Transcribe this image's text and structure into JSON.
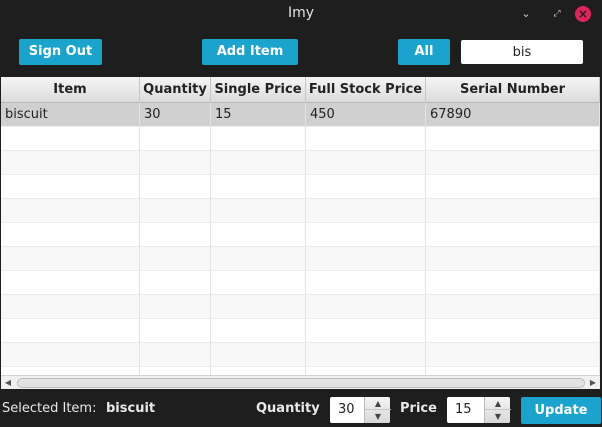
{
  "window": {
    "title": "Imy",
    "minimize_glyph": "⌄",
    "maximize_glyph": "⤢",
    "close_glyph": "×"
  },
  "toolbar": {
    "sign_out_label": "Sign Out",
    "add_item_label": "Add Item",
    "all_label": "All",
    "search_value": "bis"
  },
  "table": {
    "columns": [
      "Item",
      "Quantity",
      "Single Price",
      "Full Stock Price",
      "Serial Number"
    ],
    "rows": [
      [
        "biscuit",
        "30",
        "15",
        "450",
        "67890"
      ]
    ]
  },
  "scrollbar": {
    "left_arrow": "◀",
    "right_arrow": "▶"
  },
  "footer": {
    "selected_label": "Selected Item:",
    "selected_value": "biscuit",
    "quantity_label": "Quantity",
    "quantity_value": "30",
    "price_label": "Price",
    "price_value": "15",
    "update_label": "Update",
    "spin_up": "▲",
    "spin_down": "▼"
  },
  "colors": {
    "accent": "#1aa3cc",
    "background": "#1e1e1e",
    "close_button": "#e0245a",
    "selected_row": "#d0d0d0"
  }
}
